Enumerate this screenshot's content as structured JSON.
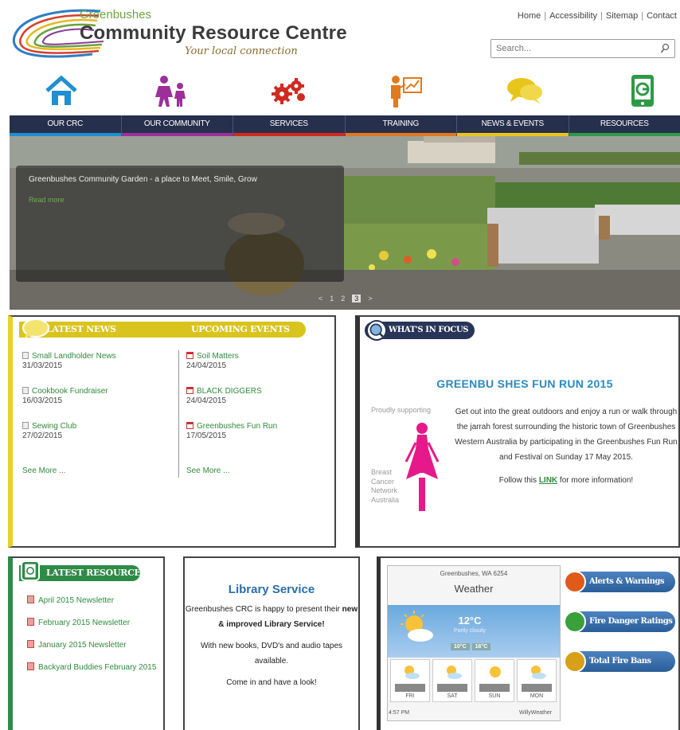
{
  "header": {
    "logo_top": "Greenbushes",
    "logo_main": "Community Resource Centre",
    "tagline": "Your local connection",
    "links": [
      "Home",
      "Accessibility",
      "Sitemap",
      "Contact"
    ],
    "search_placeholder": "Search..."
  },
  "nav": {
    "items": [
      {
        "label": "OUR CRC",
        "icon": "home-icon",
        "color": "#1f8fd1"
      },
      {
        "label": "OUR COMMUNITY",
        "icon": "people-icon",
        "color": "#9c2f9a"
      },
      {
        "label": "SERVICES",
        "icon": "gears-icon",
        "color": "#d02a20"
      },
      {
        "label": "TRAINING",
        "icon": "presenter-icon",
        "color": "#e07a1e"
      },
      {
        "label": "NEWS & EVENTS",
        "icon": "speech-bubbles-icon",
        "color": "#e8c51a"
      },
      {
        "label": "RESOURCES",
        "icon": "tablet-icon",
        "color": "#2e9a47"
      }
    ]
  },
  "hero": {
    "caption": "Greenbushes Community Garden - a place to Meet, Smile, Grow",
    "read_more": "Read more",
    "pager": [
      "<",
      "1",
      "2",
      "3",
      ">"
    ],
    "active_page": "3"
  },
  "news": {
    "latest_title": "LATEST NEWS",
    "events_title": "UPCOMING EVENTS",
    "latest": [
      {
        "title": "Small Landholder News",
        "date": "31/03/2015"
      },
      {
        "title": "Cookbook Fundraiser",
        "date": "16/03/2015"
      },
      {
        "title": "Sewing Club",
        "date": "27/02/2015"
      }
    ],
    "events": [
      {
        "title": "Soil Matters",
        "date": "24/04/2015"
      },
      {
        "title": "BLACK DIGGERS",
        "date": "24/04/2015"
      },
      {
        "title": "Greenbushes Fun Run",
        "date": "17/05/2015"
      }
    ],
    "see_more": "See More ..."
  },
  "focus": {
    "title": "WHAT'S IN FOCUS",
    "headline": "GREENBU SHES FUN RUN 2015",
    "proudly": "Proudly supporting",
    "sponsor_lines": [
      "Breast",
      "Cancer",
      "Network",
      "Australia"
    ],
    "desc_1": "Get out into the great outdoors and enjoy a run or walk through the jarrah forest surrounding the historic town of Greenbushes Western Australia by participating in the Greenbushes Fun Run and Festival on Sunday 17 May 2015.",
    "follow_pre": "Follow this ",
    "follow_link": "LINK",
    "follow_post": " for more information!"
  },
  "resources": {
    "title": "LATEST RESOURCES",
    "items": [
      "April 2015 Newsletter",
      "February 2015 Newsletter",
      "January 2015 Newsletter",
      "Backyard Buddies February 2015"
    ]
  },
  "library": {
    "title": "Library Service",
    "line1_pre": "Greenbushes CRC is happy to present their ",
    "line1_bold": "new & improved Library Service!",
    "line2": "With new books, DVD's and audio tapes available.",
    "line3": "Come in and have a look!"
  },
  "weather": {
    "location": "Greenbushes, WA 6254",
    "title": "Weather",
    "temp": "12°C",
    "condition": "Partly cloudy",
    "range": [
      "10°C",
      "16°C"
    ],
    "days": [
      "FRI",
      "SAT",
      "SUN",
      "MON"
    ],
    "time": "4:57 PM",
    "brand": "WillyWeather"
  },
  "alerts": [
    {
      "label": "Alerts & Warnings",
      "color": "#e05a1a"
    },
    {
      "label": "Fire Danger Ratings",
      "color": "#3aa03a"
    },
    {
      "label": "Total Fire Bans",
      "color": "#d8a018"
    }
  ]
}
